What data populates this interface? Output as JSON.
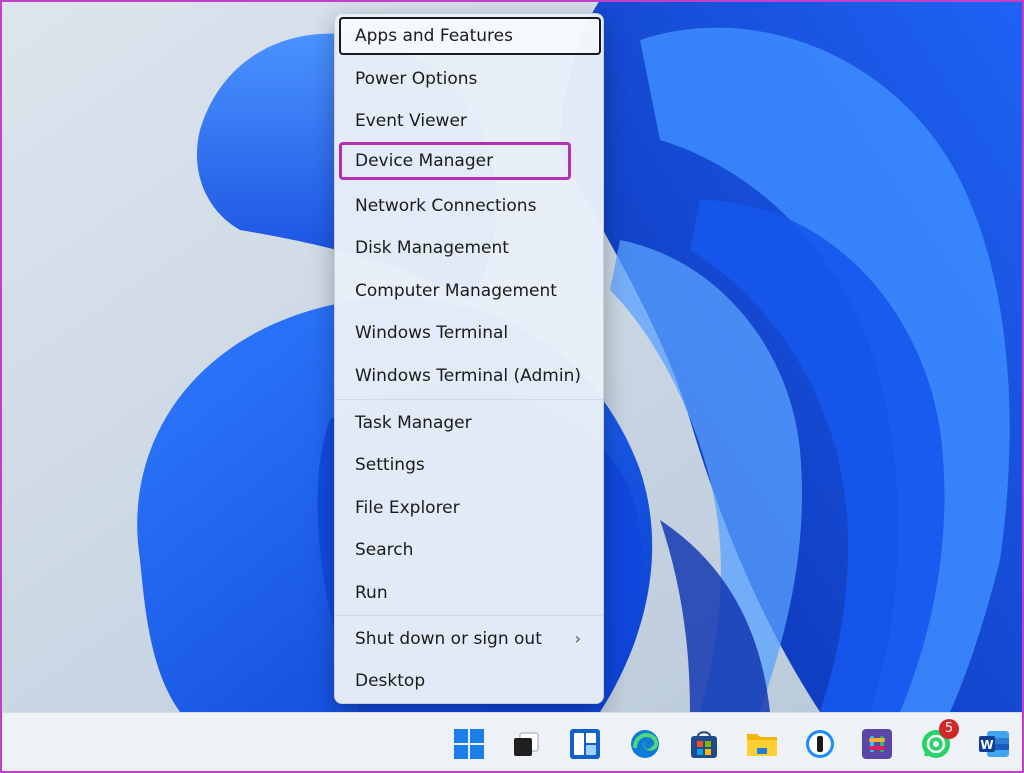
{
  "menu": {
    "items": [
      {
        "label": "Apps and Features",
        "state": "focused"
      },
      {
        "label": "Power Options"
      },
      {
        "label": "Event Viewer"
      },
      {
        "label": "Device Manager",
        "state": "highlighted"
      },
      {
        "label": "Network Connections"
      },
      {
        "label": "Disk Management"
      },
      {
        "label": "Computer Management"
      },
      {
        "label": "Windows Terminal"
      },
      {
        "label": "Windows Terminal (Admin)"
      },
      {
        "label": "Task Manager"
      },
      {
        "label": "Settings"
      },
      {
        "label": "File Explorer"
      },
      {
        "label": "Search"
      },
      {
        "label": "Run"
      },
      {
        "label": "Shut down or sign out",
        "submenu": "chevron-right-icon"
      },
      {
        "label": "Desktop"
      }
    ]
  },
  "taskbar": {
    "apps": [
      {
        "name": "start",
        "icon": "windows-start-icon"
      },
      {
        "name": "task-view",
        "icon": "task-view-icon"
      },
      {
        "name": "widgets",
        "icon": "widgets-icon"
      },
      {
        "name": "edge",
        "icon": "edge-browser-icon"
      },
      {
        "name": "microsoft-store",
        "icon": "store-icon"
      },
      {
        "name": "file-explorer",
        "icon": "folder-icon"
      },
      {
        "name": "1password",
        "icon": "password-manager-icon"
      },
      {
        "name": "slack",
        "icon": "slack-icon"
      },
      {
        "name": "whatsapp",
        "icon": "whatsapp-icon",
        "badge": "5"
      },
      {
        "name": "word",
        "icon": "word-icon"
      }
    ]
  },
  "colors": {
    "highlight": "#b52fb5",
    "wallpaper_blue": "#1d5cf0",
    "taskbar": "#eef1f6"
  }
}
